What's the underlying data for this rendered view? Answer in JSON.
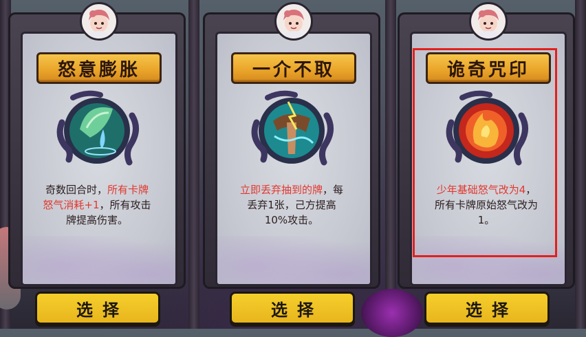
{
  "cards": [
    {
      "title": "怒意膨胀",
      "desc": [
        {
          "text": "奇数回合时，",
          "red": false
        },
        {
          "text": "所有卡牌",
          "red": true
        },
        {
          "text": "怒气消耗+1",
          "red": true
        },
        {
          "text": "，所有攻击",
          "red": false
        },
        {
          "text": "牌提高伤害。",
          "red": false
        }
      ],
      "emblem": "leaf-water-icon",
      "button": "选择",
      "selected": false
    },
    {
      "title": "一介不取",
      "desc": [
        {
          "text": "立即丢弃抽到的牌",
          "red": true
        },
        {
          "text": "，每",
          "red": false
        },
        {
          "text": "丢弃1张，己方提高",
          "red": false
        },
        {
          "text": "10%攻击。",
          "red": false
        }
      ],
      "emblem": "lightning-hand-icon",
      "button": "选择",
      "selected": false
    },
    {
      "title": "诡奇咒印",
      "desc": [
        {
          "text": "少年基础怒气改为4",
          "red": true
        },
        {
          "text": "，",
          "red": false
        },
        {
          "text": "所有卡牌原始怒气改为",
          "red": false
        },
        {
          "text": "1。",
          "red": false
        }
      ],
      "emblem": "fire-orb-icon",
      "button": "选择",
      "selected": true
    }
  ],
  "colors": {
    "title_plate": "#e9a329",
    "button": "#f5cf2c",
    "highlight": "#e0392e",
    "selection_border": "#e3201c"
  }
}
